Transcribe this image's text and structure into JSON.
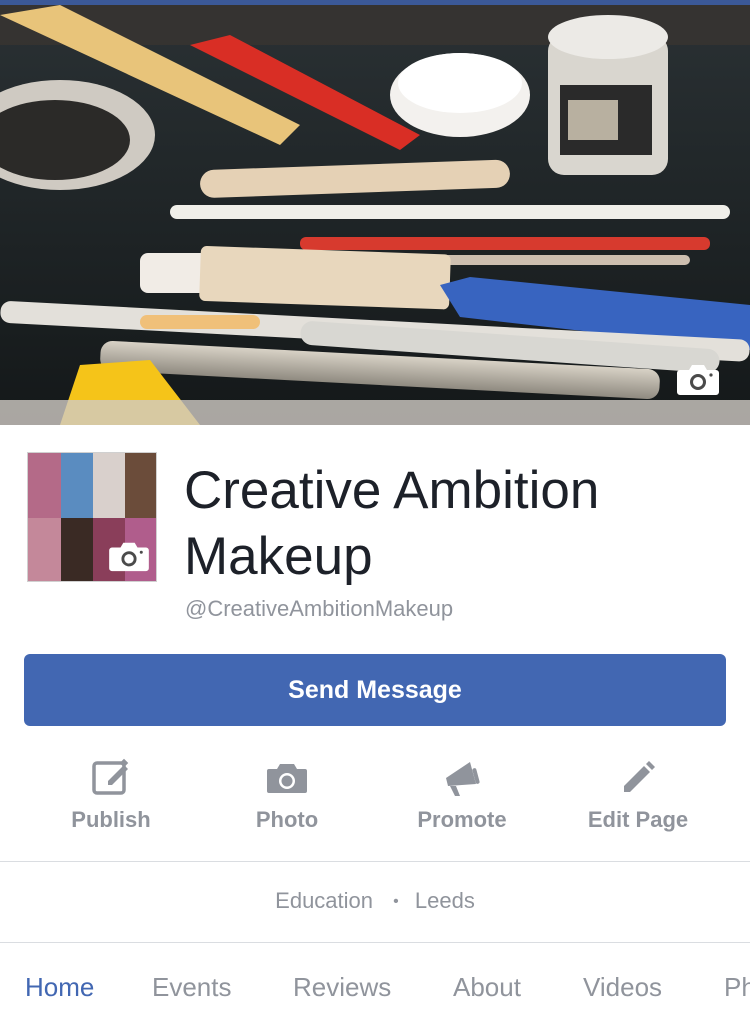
{
  "cover": {
    "image_label": "",
    "camera_icon": "camera-icon"
  },
  "profile": {
    "title": "Creative Ambition Makeup",
    "handle": "@CreativeAmbitionMakeup",
    "camera_icon": "camera-icon"
  },
  "send_message": {
    "label": "Send Message"
  },
  "actions": [
    {
      "label": "Publish",
      "icon": "compose-icon"
    },
    {
      "label": "Photo",
      "icon": "camera-icon"
    },
    {
      "label": "Promote",
      "icon": "megaphone-icon"
    },
    {
      "label": "Edit Page",
      "icon": "pencil-icon"
    }
  ],
  "category": {
    "type": "Education",
    "location": "Leeds",
    "separator": "•"
  },
  "tabs": [
    {
      "label": "Home",
      "active": true
    },
    {
      "label": "Events",
      "active": false
    },
    {
      "label": "Reviews",
      "active": false
    },
    {
      "label": "About",
      "active": false
    },
    {
      "label": "Videos",
      "active": false
    },
    {
      "label": "Ph",
      "active": false
    }
  ],
  "colors": {
    "brand_blue": "#4267b2",
    "header_blue": "#3b5998",
    "muted_text": "#90949c",
    "title_text": "#1d2129"
  }
}
